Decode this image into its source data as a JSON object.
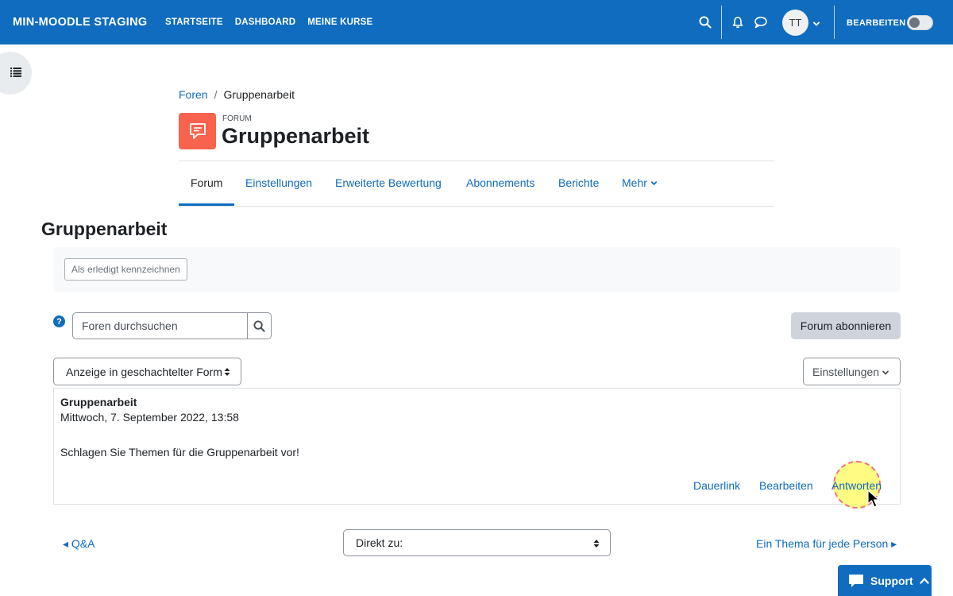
{
  "navbar": {
    "brand": "MIN-MOODLE STAGING",
    "links": [
      "STARTSEITE",
      "DASHBOARD",
      "MEINE KURSE"
    ],
    "avatar_initials": "TT",
    "edit_mode_label": "BEARBEITEN",
    "edit_mode_on": false,
    "color": "#0f6cbf"
  },
  "breadcrumb": {
    "parent": "Foren",
    "separator": "/",
    "current": "Gruppenarbeit"
  },
  "header": {
    "module_label": "FORUM",
    "title": "Gruppenarbeit",
    "icon_color": "#f7634d"
  },
  "secondary_nav": {
    "items": [
      "Forum",
      "Einstellungen",
      "Erweiterte Bewertung",
      "Abonnements",
      "Berichte",
      "Mehr"
    ],
    "active": "Forum"
  },
  "page_heading": "Gruppenarbeit",
  "completion": {
    "mark_done_label": "Als erledigt kennzeichnen"
  },
  "search": {
    "placeholder": "Foren durchsuchen"
  },
  "subscribe_label": "Forum abonnieren",
  "display_mode": {
    "selected": "Anzeige in geschachtelter Form"
  },
  "settings_label": "Einstellungen",
  "post": {
    "subject": "Gruppenarbeit",
    "date": "Mittwoch, 7. September 2022, 13:58",
    "content": "Schlagen Sie Themen für die Gruppenarbeit vor!",
    "actions": [
      "Dauerlink",
      "Bearbeiten",
      "Antworten"
    ]
  },
  "navigation": {
    "prev": "◂ Q&A",
    "jump_placeholder": "Direkt zu:",
    "next": "Ein Thema für jede Person ▸"
  },
  "support_label": "Support"
}
